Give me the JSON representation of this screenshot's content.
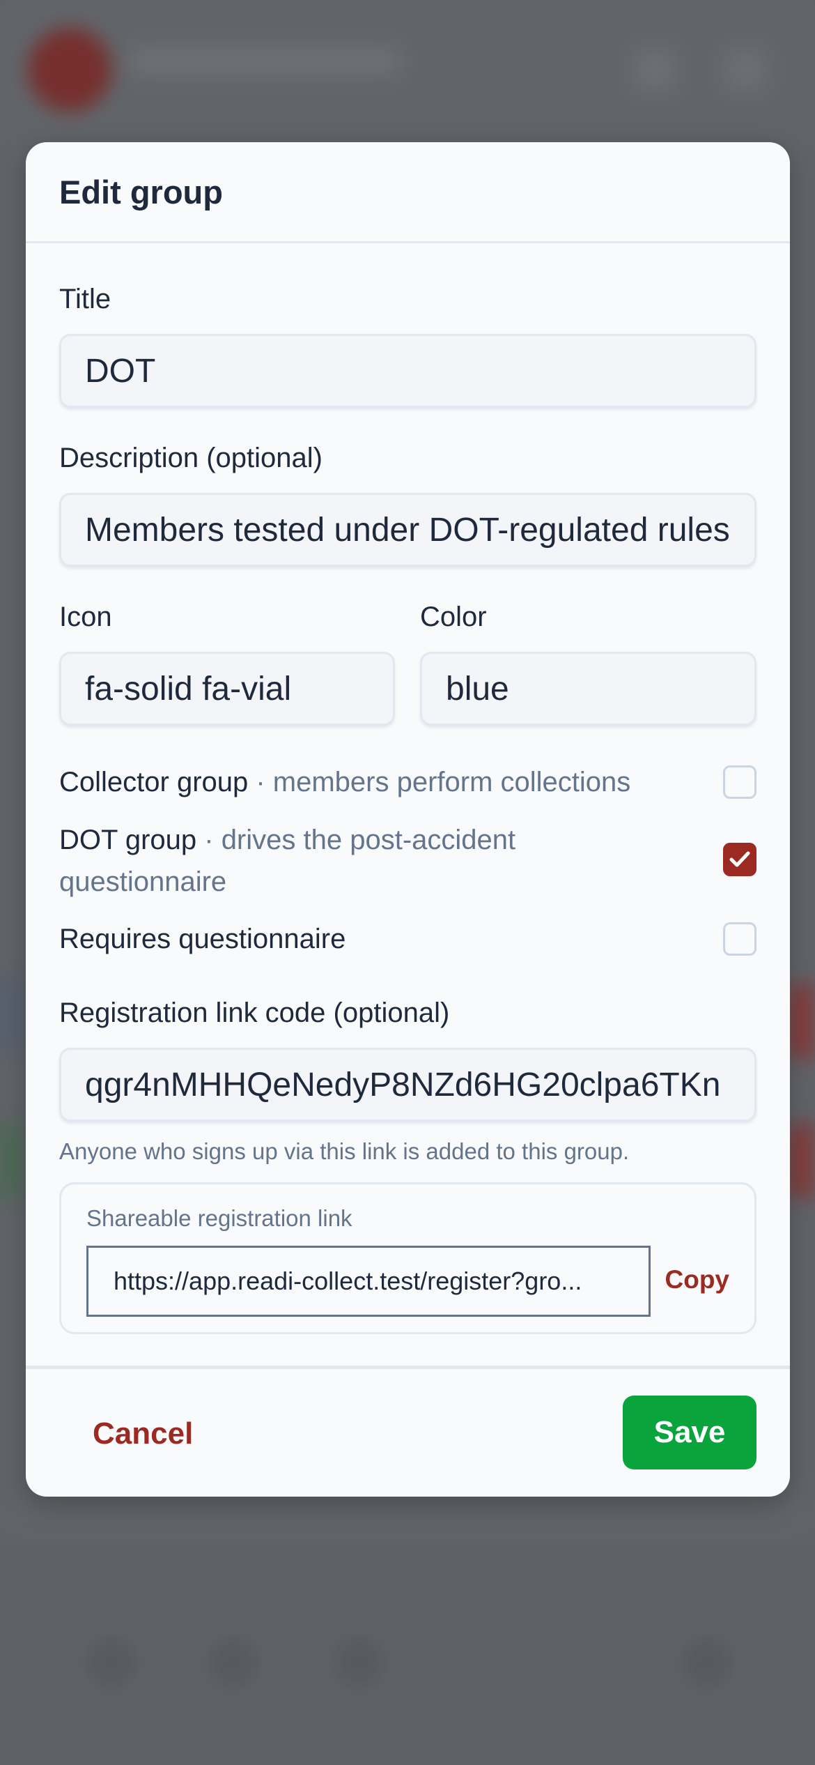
{
  "modal": {
    "title": "Edit group",
    "title_field": {
      "label": "Title",
      "value": "DOT"
    },
    "description_field": {
      "label": "Description (optional)",
      "value": "Members tested under DOT-regulated rules"
    },
    "icon_field": {
      "label": "Icon",
      "value": "fa-solid fa-vial"
    },
    "color_field": {
      "label": "Color",
      "value": "blue"
    },
    "checkboxes": [
      {
        "label": "Collector group",
        "hint": " · members perform collections",
        "checked": false
      },
      {
        "label": "DOT group",
        "hint": " · drives the post-accident questionnaire",
        "checked": true
      },
      {
        "label": "Requires questionnaire",
        "hint": "",
        "checked": false
      }
    ],
    "registration_code": {
      "label": "Registration link code (optional)",
      "value": "qgr4nMHHQeNedyP8NZd6HG20clpa6TKn",
      "help": "Anyone who signs up via this link is added to this group."
    },
    "shareable_link": {
      "label": "Shareable registration link",
      "value": "https://app.readi-collect.test/register?gro...",
      "copy_label": "Copy"
    },
    "footer": {
      "cancel_label": "Cancel",
      "save_label": "Save"
    }
  },
  "colors": {
    "accent_red": "#9b2a22",
    "save_green": "#0aa43c"
  }
}
